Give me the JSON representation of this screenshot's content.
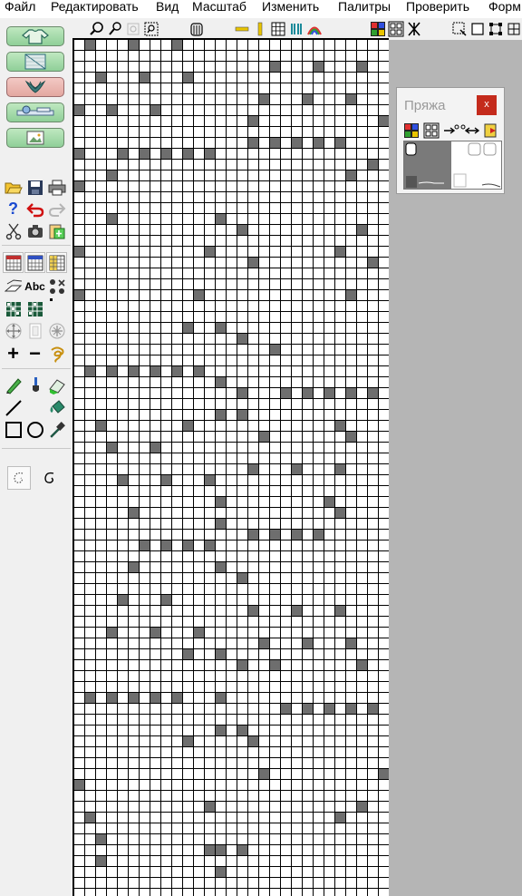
{
  "menu": {
    "file": "Файл",
    "edit": "Редактировать",
    "view": "Вид",
    "scale": "Масштаб",
    "modify": "Изменить",
    "palettes": "Палитры",
    "check": "Проверить",
    "format": "Форм"
  },
  "yarn_palette": {
    "title": "Пряжа",
    "close": "x"
  },
  "left_tools": {
    "text_tool": "Abc",
    "plus": "+",
    "minus": "−"
  },
  "colors": {
    "filled_cell": "#6e6e6e",
    "grid_line": "#000000",
    "workspace": "#b5b5b5",
    "close_button": "#c42b1c"
  },
  "stitch_grid": {
    "columns": 29,
    "rows": 79,
    "filled_cells": [
      [
        1,
        0
      ],
      [
        5,
        0
      ],
      [
        9,
        0
      ],
      [
        18,
        2
      ],
      [
        22,
        2
      ],
      [
        26,
        2
      ],
      [
        2,
        3
      ],
      [
        6,
        3
      ],
      [
        10,
        3
      ],
      [
        17,
        5
      ],
      [
        21,
        5
      ],
      [
        25,
        5
      ],
      [
        0,
        6
      ],
      [
        3,
        6
      ],
      [
        7,
        6
      ],
      [
        16,
        7
      ],
      [
        28,
        7
      ],
      [
        16,
        9
      ],
      [
        18,
        9
      ],
      [
        20,
        9
      ],
      [
        22,
        9
      ],
      [
        24,
        9
      ],
      [
        0,
        10
      ],
      [
        4,
        10
      ],
      [
        6,
        10
      ],
      [
        8,
        10
      ],
      [
        10,
        10
      ],
      [
        12,
        10
      ],
      [
        27,
        11
      ],
      [
        3,
        12
      ],
      [
        25,
        12
      ],
      [
        0,
        13
      ],
      [
        3,
        16
      ],
      [
        13,
        16
      ],
      [
        15,
        17
      ],
      [
        26,
        17
      ],
      [
        0,
        19
      ],
      [
        12,
        19
      ],
      [
        24,
        19
      ],
      [
        16,
        20
      ],
      [
        27,
        20
      ],
      [
        0,
        23
      ],
      [
        11,
        23
      ],
      [
        25,
        23
      ],
      [
        10,
        26
      ],
      [
        13,
        26
      ],
      [
        15,
        27
      ],
      [
        18,
        28
      ],
      [
        1,
        30
      ],
      [
        3,
        30
      ],
      [
        5,
        30
      ],
      [
        7,
        30
      ],
      [
        9,
        30
      ],
      [
        11,
        30
      ],
      [
        13,
        31
      ],
      [
        15,
        32
      ],
      [
        19,
        32
      ],
      [
        21,
        32
      ],
      [
        23,
        32
      ],
      [
        25,
        32
      ],
      [
        27,
        32
      ],
      [
        13,
        34
      ],
      [
        15,
        34
      ],
      [
        2,
        35
      ],
      [
        10,
        35
      ],
      [
        24,
        35
      ],
      [
        17,
        36
      ],
      [
        25,
        36
      ],
      [
        3,
        37
      ],
      [
        7,
        37
      ],
      [
        16,
        39
      ],
      [
        20,
        39
      ],
      [
        24,
        39
      ],
      [
        4,
        40
      ],
      [
        8,
        40
      ],
      [
        12,
        40
      ],
      [
        13,
        42
      ],
      [
        23,
        42
      ],
      [
        5,
        43
      ],
      [
        24,
        43
      ],
      [
        13,
        44
      ],
      [
        16,
        45
      ],
      [
        18,
        45
      ],
      [
        20,
        45
      ],
      [
        22,
        45
      ],
      [
        6,
        46
      ],
      [
        8,
        46
      ],
      [
        10,
        46
      ],
      [
        12,
        46
      ],
      [
        5,
        48
      ],
      [
        13,
        48
      ],
      [
        15,
        49
      ],
      [
        4,
        51
      ],
      [
        8,
        51
      ],
      [
        16,
        52
      ],
      [
        20,
        52
      ],
      [
        24,
        52
      ],
      [
        3,
        54
      ],
      [
        7,
        54
      ],
      [
        11,
        54
      ],
      [
        17,
        55
      ],
      [
        21,
        55
      ],
      [
        25,
        55
      ],
      [
        10,
        56
      ],
      [
        13,
        56
      ],
      [
        15,
        57
      ],
      [
        18,
        57
      ],
      [
        26,
        57
      ],
      [
        1,
        60
      ],
      [
        3,
        60
      ],
      [
        5,
        60
      ],
      [
        7,
        60
      ],
      [
        9,
        60
      ],
      [
        13,
        60
      ],
      [
        19,
        61
      ],
      [
        21,
        61
      ],
      [
        23,
        61
      ],
      [
        25,
        61
      ],
      [
        27,
        61
      ],
      [
        13,
        63
      ],
      [
        15,
        63
      ],
      [
        10,
        64
      ],
      [
        16,
        64
      ],
      [
        17,
        67
      ],
      [
        28,
        67
      ],
      [
        0,
        68
      ],
      [
        12,
        70
      ],
      [
        26,
        70
      ],
      [
        1,
        71
      ],
      [
        24,
        71
      ],
      [
        2,
        73
      ],
      [
        12,
        74
      ],
      [
        13,
        74
      ],
      [
        15,
        74
      ],
      [
        2,
        75
      ],
      [
        13,
        76
      ]
    ]
  }
}
